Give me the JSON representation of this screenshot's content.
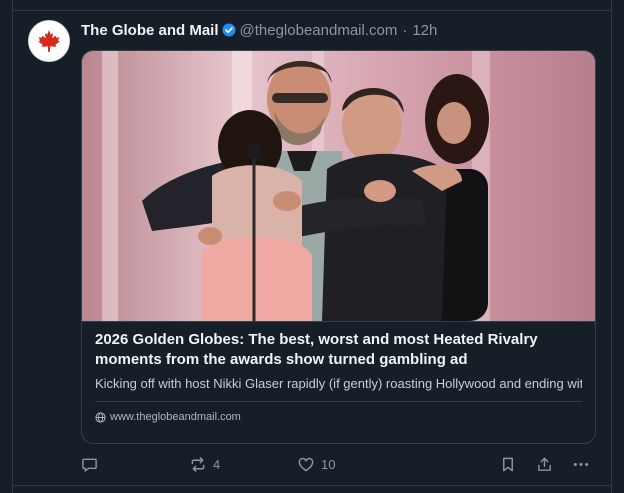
{
  "post": {
    "author": "The Globe and Mail",
    "handle": "@theglobeandmail.com",
    "separator": "·",
    "time": "12h",
    "avatar_icon": "maple-leaf-icon",
    "verified_icon": "verified-badge-icon"
  },
  "link_card": {
    "title": "2026 Golden Globes: The best, worst and most Heated Rivalry moments from the awards show turned gambling ad",
    "description": "Kicking off with host Nikki Glaser rapidly (if gently) roasting Hollywood and ending with The Pitt, The Studio, Hamnet, and One Battle After Another takin…",
    "domain": "www.theglobeandmail.com",
    "domain_icon": "globe-icon"
  },
  "actions": {
    "reply_icon": "comment-icon",
    "repost_count": "4",
    "like_count": "10"
  },
  "colors": {
    "background": "#161e27",
    "border": "#2e3a48",
    "muted_text": "#8b98a5",
    "accent_blue": "#208bfe",
    "brand_red": "#d52b1e"
  }
}
